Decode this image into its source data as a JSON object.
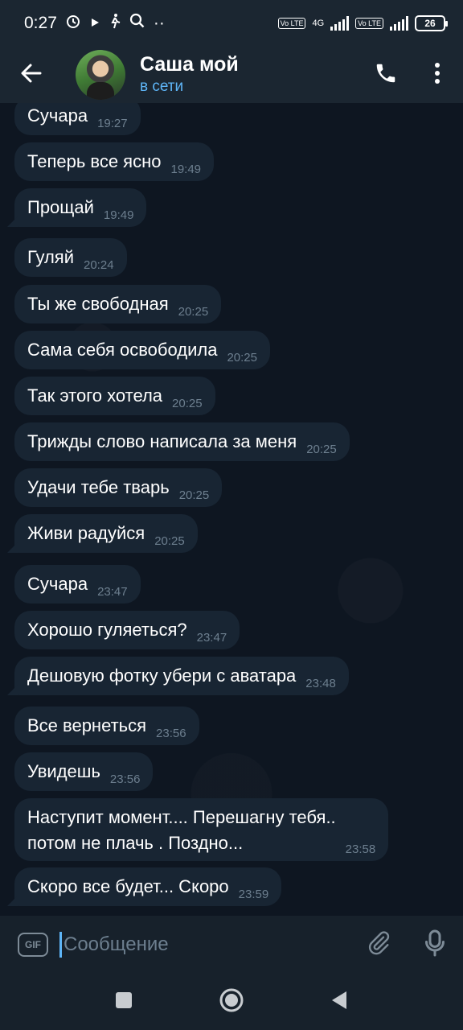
{
  "status_bar": {
    "time": "0:27",
    "network": "4G",
    "volte_1": "Vo LTE",
    "volte_2": "Vo LTE",
    "battery": "26"
  },
  "header": {
    "name": "Саша мой",
    "status": "в сети"
  },
  "messages": [
    {
      "text": "Сучара",
      "time": "19:27"
    },
    {
      "text": "Теперь все ясно",
      "time": "19:49"
    },
    {
      "text": "Прощай",
      "time": "19:49"
    },
    {
      "text": "Гуляй",
      "time": "20:24"
    },
    {
      "text": "Ты же свободная",
      "time": "20:25"
    },
    {
      "text": "Сама себя освободила",
      "time": "20:25"
    },
    {
      "text": "Так этого хотела",
      "time": "20:25"
    },
    {
      "text": "Трижды слово написала за меня",
      "time": "20:25"
    },
    {
      "text": "Удачи тебе тварь",
      "time": "20:25"
    },
    {
      "text": "Живи радуйся",
      "time": "20:25"
    },
    {
      "text": "Сучара",
      "time": "23:47"
    },
    {
      "text": "Хорошо гуляеться?",
      "time": "23:47"
    },
    {
      "text": "Дешовую фотку убери с аватара",
      "time": "23:48"
    },
    {
      "text": "Все вернеться",
      "time": "23:56"
    },
    {
      "text": "Увидешь",
      "time": "23:56"
    },
    {
      "text": "Наступит момент.... Перешагну тебя..\nпотом не плачь . Поздно...",
      "time": "23:58"
    },
    {
      "text": "Скоро все будет... Скоро",
      "time": "23:59"
    }
  ],
  "composer": {
    "gif_label": "GIF",
    "placeholder": "Сообщение"
  },
  "colors": {
    "background": "#0e1621",
    "bubble": "#182533",
    "accent": "#5eb5f7"
  }
}
